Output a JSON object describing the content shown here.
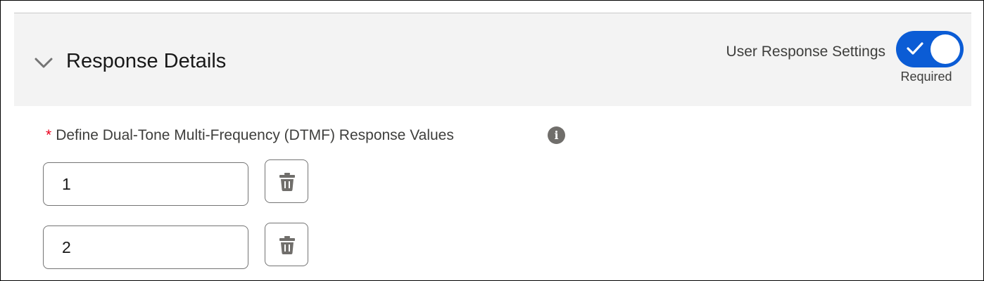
{
  "section": {
    "title": "Response Details",
    "collapse_icon": "chevron-down-icon"
  },
  "user_response_settings": {
    "label": "User Response Settings",
    "toggle_on": true,
    "toggle_state_text": "Required",
    "toggle_icon": "check-icon",
    "accent_color": "#0b5cd5"
  },
  "dtmf": {
    "required_marker": "*",
    "required_color": "#ea001e",
    "label": "Define Dual-Tone Multi-Frequency (DTMF) Response Values",
    "info_icon_glyph": "i",
    "info_icon": "info-icon",
    "values": [
      {
        "value": "1",
        "delete_icon": "trash-icon"
      },
      {
        "value": "2",
        "delete_icon": "trash-icon"
      }
    ]
  }
}
